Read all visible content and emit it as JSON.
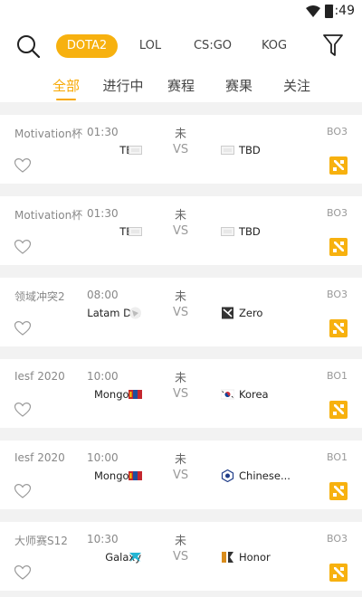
{
  "status_bar": {
    "time": "7:49"
  },
  "game_tabs": [
    "DOTA2",
    "LOL",
    "CS:GO",
    "KOG"
  ],
  "sub_tabs": [
    "全部",
    "进行中",
    "赛程",
    "赛果",
    "关注"
  ],
  "colors": {
    "accent": "#f7b10f",
    "accent_text": "#f7a800"
  },
  "matches": [
    {
      "league": "Motivation杯",
      "time": "01:30",
      "status": "未",
      "vs": "VS",
      "team_left": "TBD",
      "team_right": "TBD",
      "format": "BO3",
      "logo_left": "placeholder-flag",
      "logo_right": "placeholder-flag"
    },
    {
      "league": "Motivation杯",
      "time": "01:30",
      "status": "未",
      "vs": "VS",
      "team_left": "TBD",
      "team_right": "TBD",
      "format": "BO3",
      "logo_left": "placeholder-flag",
      "logo_right": "placeholder-flag"
    },
    {
      "league": "领域冲突2",
      "time": "08:00",
      "status": "未",
      "vs": "VS",
      "team_left": "Latam D...",
      "team_right": "Zero",
      "format": "BO3",
      "logo_left": "latam-logo",
      "logo_right": "zero-logo"
    },
    {
      "league": "Iesf 2020",
      "time": "10:00",
      "status": "未",
      "vs": "VS",
      "team_left": "Mongolia",
      "team_right": "Korea",
      "format": "BO1",
      "logo_left": "mongolia-flag",
      "logo_right": "korea-flag"
    },
    {
      "league": "Iesf 2020",
      "time": "10:00",
      "status": "未",
      "vs": "VS",
      "team_left": "Mongolia",
      "team_right": "Chinese...",
      "format": "BO1",
      "logo_left": "mongolia-flag",
      "logo_right": "chinese-taipei-flag"
    },
    {
      "league": "大师赛S12",
      "time": "10:30",
      "status": "未",
      "vs": "VS",
      "team_left": "Galaxy",
      "team_right": "Honor",
      "format": "BO3",
      "logo_left": "galaxy-logo",
      "logo_right": "honor-logo"
    }
  ]
}
